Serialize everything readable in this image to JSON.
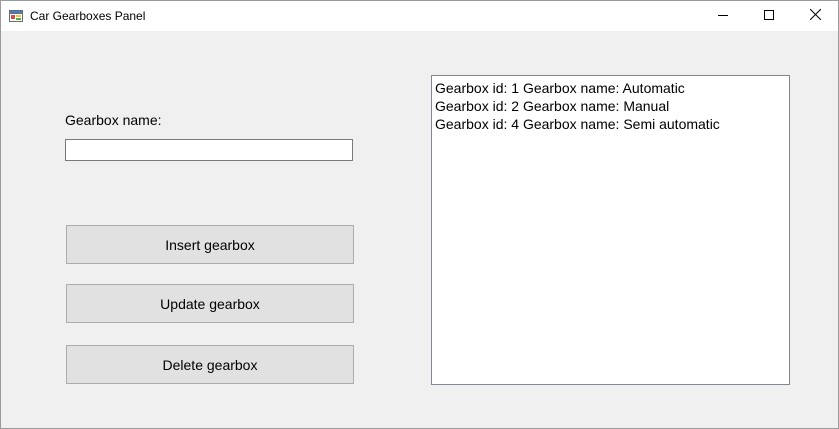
{
  "window": {
    "title": "Car Gearboxes Panel",
    "icon": "app-form-icon",
    "controls": [
      "minimize-icon",
      "maximize-icon",
      "close-icon"
    ]
  },
  "form": {
    "gearbox_name_label": "Gearbox name:",
    "gearbox_name_value": "",
    "insert_label": "Insert gearbox",
    "update_label": "Update gearbox",
    "delete_label": "Delete gearbox"
  },
  "gearbox_list": {
    "items": [
      "Gearbox id: 1 Gearbox name: Automatic",
      "Gearbox id: 2 Gearbox name: Manual",
      "Gearbox id: 4 Gearbox name: Semi automatic"
    ]
  }
}
